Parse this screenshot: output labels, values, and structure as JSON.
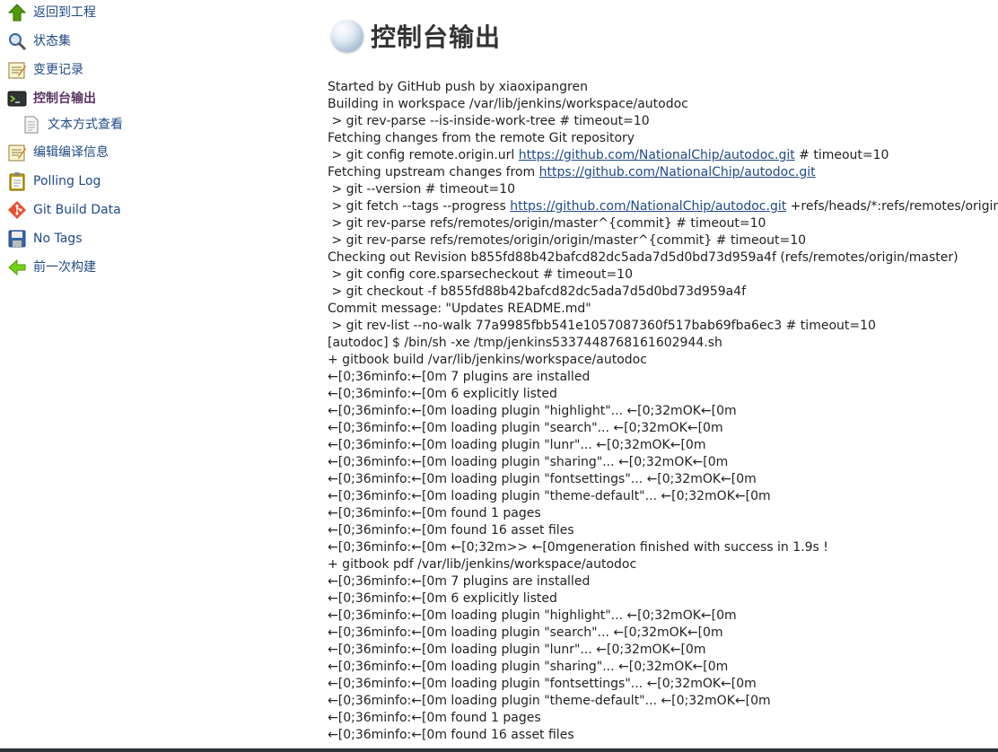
{
  "sidebar": {
    "items": [
      {
        "label": "返回到工程",
        "icon": "up-arrow-icon"
      },
      {
        "label": "状态集",
        "icon": "magnifier-icon"
      },
      {
        "label": "变更记录",
        "icon": "notepad-icon"
      },
      {
        "label": "控制台输出",
        "icon": "terminal-icon",
        "active": true
      },
      {
        "label": "文本方式查看",
        "icon": "document-icon",
        "sub": true
      },
      {
        "label": "编辑编译信息",
        "icon": "notepad-icon"
      },
      {
        "label": "Polling Log",
        "icon": "clipboard-icon"
      },
      {
        "label": "Git Build Data",
        "icon": "git-icon"
      },
      {
        "label": "No Tags",
        "icon": "floppy-disk-icon"
      },
      {
        "label": "前一次构建",
        "icon": "left-arrow-icon"
      }
    ]
  },
  "main": {
    "title": "控制台输出",
    "title_icon": "console-ball-icon"
  },
  "console": {
    "lines": [
      {
        "text": "Started by GitHub push by xiaoxipangren"
      },
      {
        "text": "Building in workspace /var/lib/jenkins/workspace/autodoc"
      },
      {
        "text": " > git rev-parse --is-inside-work-tree # timeout=10"
      },
      {
        "text": "Fetching changes from the remote Git repository"
      },
      {
        "pre": " > git config remote.origin.url ",
        "link": "https://github.com/NationalChip/autodoc.git",
        "post": " # timeout=10"
      },
      {
        "pre": "Fetching upstream changes from ",
        "link": "https://github.com/NationalChip/autodoc.git",
        "post": ""
      },
      {
        "text": " > git --version # timeout=10"
      },
      {
        "pre": " > git fetch --tags --progress ",
        "link": "https://github.com/NationalChip/autodoc.git",
        "post": " +refs/heads/*:refs/remotes/origin/*"
      },
      {
        "text": " > git rev-parse refs/remotes/origin/master^{commit} # timeout=10"
      },
      {
        "text": " > git rev-parse refs/remotes/origin/origin/master^{commit} # timeout=10"
      },
      {
        "text": "Checking out Revision b855fd88b42bafcd82dc5ada7d5d0bd73d959a4f (refs/remotes/origin/master)"
      },
      {
        "text": " > git config core.sparsecheckout # timeout=10"
      },
      {
        "text": " > git checkout -f b855fd88b42bafcd82dc5ada7d5d0bd73d959a4f"
      },
      {
        "text": "Commit message: \"Updates README.md\""
      },
      {
        "text": " > git rev-list --no-walk 77a9985fbb541e1057087360f517bab69fba6ec3 # timeout=10"
      },
      {
        "text": "[autodoc] $ /bin/sh -xe /tmp/jenkins5337448768161602944.sh"
      },
      {
        "text": "+ gitbook build /var/lib/jenkins/workspace/autodoc"
      },
      {
        "text": "←[0;36minfo:←[0m 7 plugins are installed"
      },
      {
        "text": "←[0;36minfo:←[0m 6 explicitly listed"
      },
      {
        "text": "←[0;36minfo:←[0m loading plugin \"highlight\"... ←[0;32mOK←[0m"
      },
      {
        "text": "←[0;36minfo:←[0m loading plugin \"search\"... ←[0;32mOK←[0m"
      },
      {
        "text": "←[0;36minfo:←[0m loading plugin \"lunr\"... ←[0;32mOK←[0m"
      },
      {
        "text": "←[0;36minfo:←[0m loading plugin \"sharing\"... ←[0;32mOK←[0m"
      },
      {
        "text": "←[0;36minfo:←[0m loading plugin \"fontsettings\"... ←[0;32mOK←[0m"
      },
      {
        "text": "←[0;36minfo:←[0m loading plugin \"theme-default\"... ←[0;32mOK←[0m"
      },
      {
        "text": "←[0;36minfo:←[0m found 1 pages"
      },
      {
        "text": "←[0;36minfo:←[0m found 16 asset files"
      },
      {
        "text": "←[0;36minfo:←[0m ←[0;32m>> ←[0mgeneration finished with success in 1.9s !"
      },
      {
        "text": "+ gitbook pdf /var/lib/jenkins/workspace/autodoc"
      },
      {
        "text": "←[0;36minfo:←[0m 7 plugins are installed"
      },
      {
        "text": "←[0;36minfo:←[0m 6 explicitly listed"
      },
      {
        "text": "←[0;36minfo:←[0m loading plugin \"highlight\"... ←[0;32mOK←[0m"
      },
      {
        "text": "←[0;36minfo:←[0m loading plugin \"search\"... ←[0;32mOK←[0m"
      },
      {
        "text": "←[0;36minfo:←[0m loading plugin \"lunr\"... ←[0;32mOK←[0m"
      },
      {
        "text": "←[0;36minfo:←[0m loading plugin \"sharing\"... ←[0;32mOK←[0m"
      },
      {
        "text": "←[0;36minfo:←[0m loading plugin \"fontsettings\"... ←[0;32mOK←[0m"
      },
      {
        "text": "←[0;36minfo:←[0m loading plugin \"theme-default\"... ←[0;32mOK←[0m"
      },
      {
        "text": "←[0;36minfo:←[0m found 1 pages"
      },
      {
        "text": "←[0;36minfo:←[0m found 16 asset files"
      }
    ]
  }
}
